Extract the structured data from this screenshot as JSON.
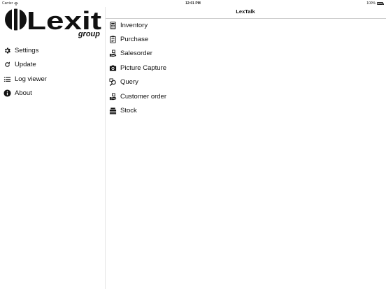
{
  "status_bar": {
    "carrier": "Carrier",
    "time": "12:01 PM",
    "battery": "100%"
  },
  "nav": {
    "title": "LexTalk"
  },
  "logo": {
    "wordmark": "Lexit",
    "subtitle": "group"
  },
  "sidebar": {
    "items": [
      {
        "label": "Settings",
        "icon": "gear-icon"
      },
      {
        "label": "Update",
        "icon": "refresh-icon"
      },
      {
        "label": "Log viewer",
        "icon": "list-icon"
      },
      {
        "label": "About",
        "icon": "info-icon"
      }
    ]
  },
  "main": {
    "items": [
      {
        "label": "Inventory",
        "icon": "calculator-icon"
      },
      {
        "label": "Purchase",
        "icon": "clipboard-icon"
      },
      {
        "label": "Salesorder",
        "icon": "hand-box-icon"
      },
      {
        "label": "Picture Capture",
        "icon": "camera-icon"
      },
      {
        "label": "Query",
        "icon": "magnifier-icon"
      },
      {
        "label": "Customer order",
        "icon": "hand-box-icon"
      },
      {
        "label": "Stock",
        "icon": "stack-icon"
      }
    ]
  },
  "colors": {
    "text": "#111111",
    "divider": "#e6e6e6",
    "nav_border": "#cfcfcf",
    "background": "#ffffff"
  }
}
